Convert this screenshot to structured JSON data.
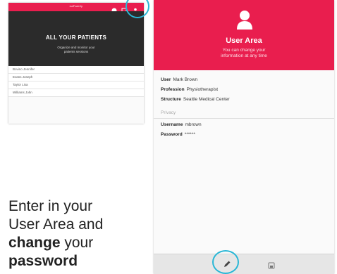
{
  "left_screen": {
    "brand": "naFamily",
    "hero_title": "ALL YOUR PATIENTS",
    "hero_subtitle_line1": "Organize and monitor your",
    "hero_subtitle_line2": "patients sessions",
    "patients": [
      "Bovino Jennifer",
      "Evans Joseph",
      "Taylor Lisa",
      "Williams John"
    ],
    "icons": [
      "info-icon",
      "settings-icon",
      "user-icon"
    ]
  },
  "right_screen": {
    "title": "User Area",
    "subtitle_line1": "You can change your",
    "subtitle_line2": "information at any time",
    "fields": [
      {
        "label": "User",
        "value": "Mark Brown"
      },
      {
        "label": "Profession",
        "value": "Physiotherapist"
      },
      {
        "label": "Structure",
        "value": "Seattle Medical Center"
      }
    ],
    "privacy_section": "Privacy",
    "privacy_fields": [
      {
        "label": "Username",
        "value": "mbrown"
      },
      {
        "label": "Password",
        "value": "******"
      }
    ],
    "icons": [
      "edit-icon",
      "save-icon"
    ]
  },
  "caption": {
    "line1": "Enter in your",
    "line2": "User Area and",
    "line3_bold": "change",
    "line3_rest": " your",
    "line4_bold": "password"
  },
  "colors": {
    "accent": "#e91e4e",
    "highlight": "#2ab7d6",
    "hero_bg": "#2b2b2b"
  }
}
